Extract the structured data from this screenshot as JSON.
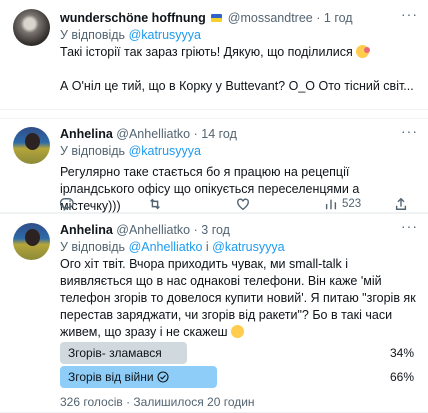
{
  "tweet1": {
    "name": "wunderschöne hoffnung",
    "handle": "@mossandtree",
    "dot": "·",
    "time": "1 год",
    "reply_prefix": "У відповідь",
    "reply_to": "@katrusyyya",
    "line1": "Такі історії так зараз гріють! Дякую, що поділилися",
    "line2": "А О'ніл це тий, що в Корку у Buttevant? О_О Ото тісний світ..."
  },
  "tweet2": {
    "name": "Anhelina",
    "handle": "@Anhelliatko",
    "dot": "·",
    "time": "14 год",
    "reply_prefix": "У відповідь",
    "reply_to": "@katrusyyya",
    "text": "Регулярно таке стається бо я працюю на рецепції ірландського офісу що опікується переселенцями а містечку)))",
    "reply_count": "",
    "retweet_count": "",
    "like_count": "",
    "views_count": "523"
  },
  "tweet3": {
    "name": "Anhelina",
    "handle": "@Anhelliatko",
    "dot": "·",
    "time": "3 год",
    "reply_prefix": "У відповідь",
    "reply_to_1": "@Anhelliatko",
    "reply_and": "і",
    "reply_to_2": "@katrusyyya",
    "text": "Ого хіт твіт. Вчора приходить чувак, ми small-talk і виявляється що в нас однакові телефони. Він каже 'мій телефон згорів то довелося купити новий'. Я питаю \"згорів як перестав заряджати, чи згорів від ракети\"? Бо в такі часи живем, що зразу і не скажеш",
    "question": "Що чувак відповів?",
    "poll": {
      "options": [
        {
          "label": "Згорів- зламався",
          "percent": "34%",
          "value": 34,
          "winner": false
        },
        {
          "label": "Згорів від війни",
          "percent": "66%",
          "value": 66,
          "winner": true
        }
      ],
      "votes": "326 голосів",
      "sep": "·",
      "remaining": "Залишилося 20 годин"
    }
  },
  "colors": {
    "accent": "#1d9bf0",
    "poll_winner": "#8ecdf8",
    "poll_other": "#cfd9de"
  }
}
